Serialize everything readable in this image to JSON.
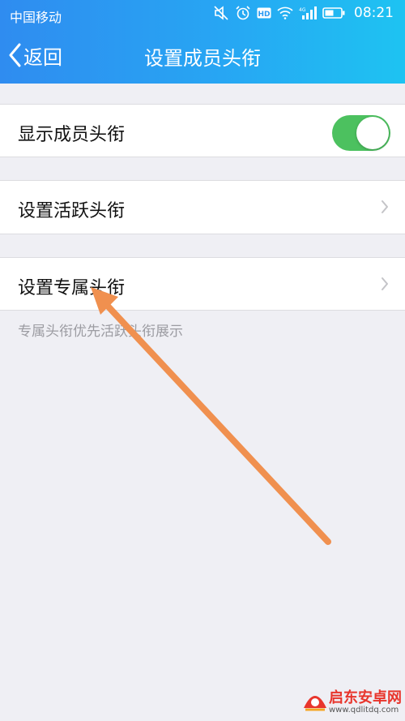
{
  "status_bar": {
    "carrier": "中国移动",
    "time": "08:21",
    "icons": [
      "mute-icon",
      "alarm-icon",
      "hd-icon",
      "wifi-icon",
      "signal-4g-icon",
      "battery-icon"
    ]
  },
  "navbar": {
    "back_label": "返回",
    "title": "设置成员头衔"
  },
  "settings": {
    "show_member_title": {
      "label": "显示成员头衔",
      "enabled": true
    },
    "active_title": {
      "label": "设置活跃头衔"
    },
    "exclusive_title": {
      "label": "设置专属头衔"
    },
    "footnote": "专属头衔优先活跃头衔展示"
  },
  "colors": {
    "header_start": "#2f8cf0",
    "header_end": "#1ec3f2",
    "toggle_on": "#4cc15f",
    "annotation_arrow": "#f0904f",
    "page_bg": "#efeff4"
  },
  "watermark": {
    "title": "启东安卓网",
    "url": "www.qdlitdq.com"
  }
}
